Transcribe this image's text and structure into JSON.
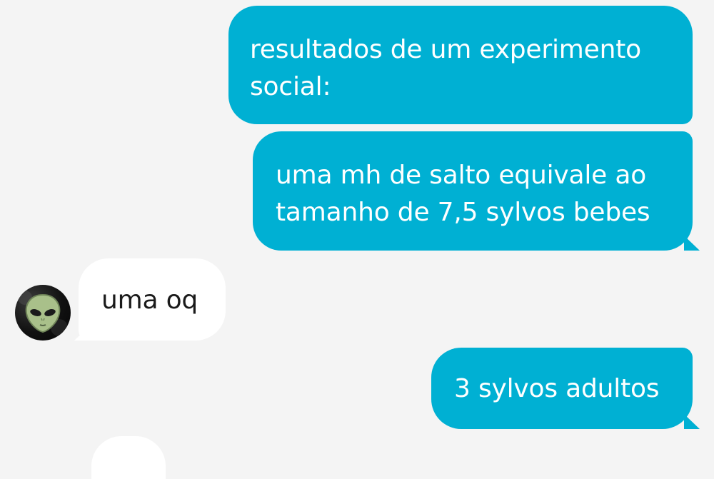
{
  "messages": [
    {
      "direction": "outgoing",
      "text": "resultados de um experimento social:"
    },
    {
      "direction": "outgoing",
      "text": "uma mh de salto equivale ao tamanho de 7,5 sylvos bebes"
    },
    {
      "direction": "incoming",
      "text": "uma oq"
    },
    {
      "direction": "outgoing",
      "text": "3 sylvos adultos"
    }
  ],
  "contact": {
    "avatar_icon": "alien-avatar-icon"
  },
  "colors": {
    "outgoing_bubble": "#00b0d3",
    "incoming_bubble": "#ffffff",
    "background": "#f4f4f4"
  }
}
